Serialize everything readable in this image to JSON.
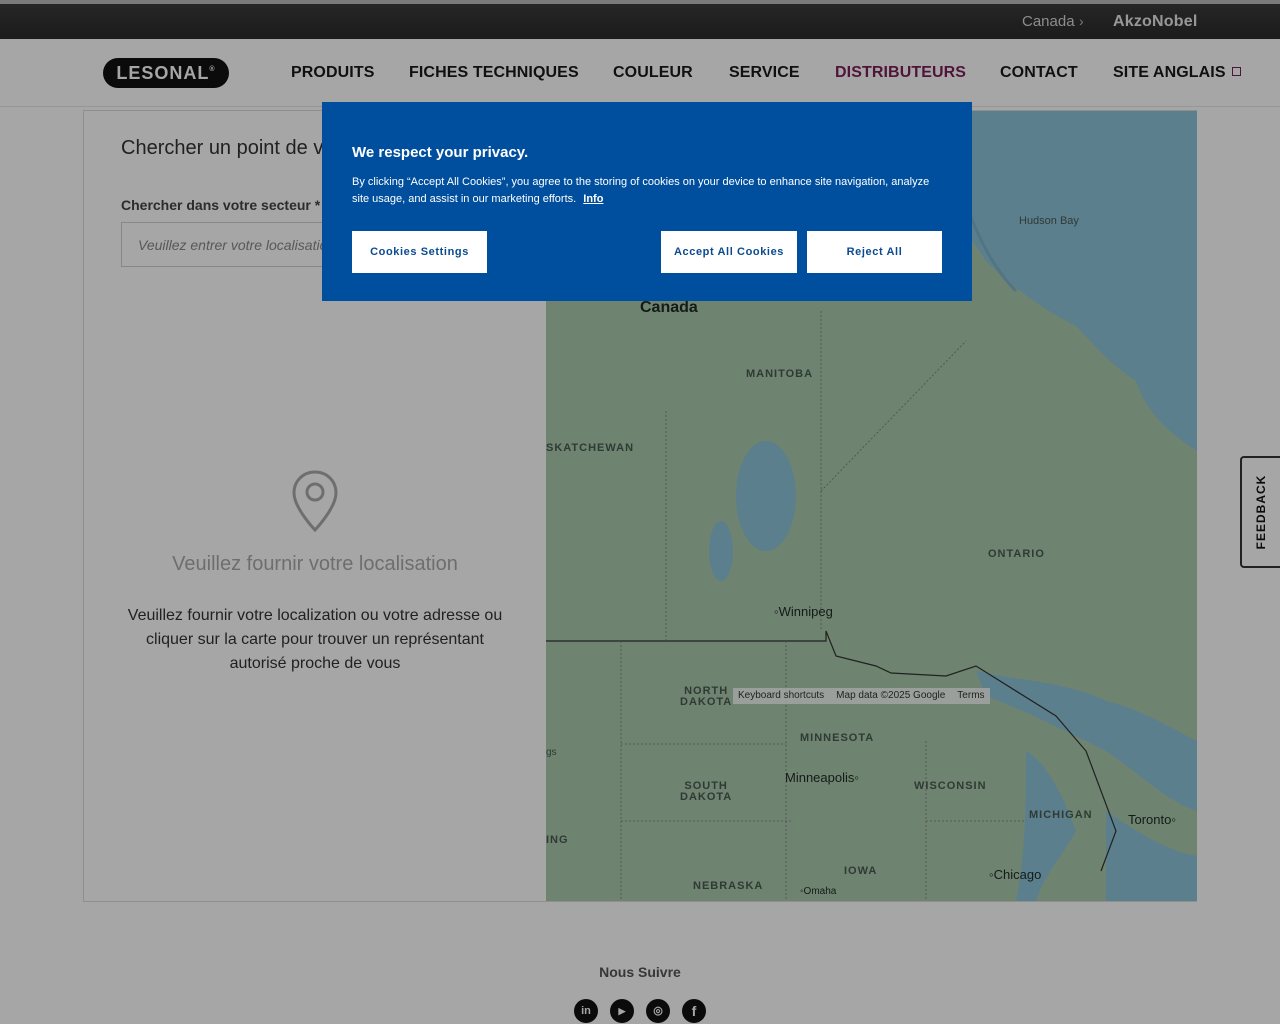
{
  "topbar": {
    "country": "Canada",
    "chevron": "›",
    "brand": "AkzoNobel"
  },
  "header": {
    "logo": "LESONAL",
    "logo_mark": "®",
    "nav": [
      {
        "label": "PRODUITS"
      },
      {
        "label": "FICHES TECHNIQUES"
      },
      {
        "label": "COULEUR"
      },
      {
        "label": "SERVICE"
      },
      {
        "label": "DISTRIBUTEURS",
        "active": true
      },
      {
        "label": "CONTACT"
      },
      {
        "label": "SITE ANGLAIS",
        "icon": "external-link-icon"
      }
    ]
  },
  "locator": {
    "title": "Chercher un point de vente",
    "search_label": "Chercher dans votre secteur *",
    "search_placeholder": "Veuillez entrer votre localisation",
    "empty_heading": "Veuillez fournir votre localisation",
    "empty_text": "Veuillez fournir votre localization ou votre adresse ou cliquer sur la carte pour trouver un représentant autorisé proche de vous"
  },
  "map": {
    "labels": {
      "hudson_bay": "Hudson Bay",
      "canada": "Canada",
      "manitoba": "MANITOBA",
      "saskatchewan": "SKATCHEWAN",
      "ontario": "ONTARIO",
      "north_dakota": "NORTH\nDAKOTA",
      "minnesota": "MINNESOTA",
      "south_dakota": "SOUTH\nDAKOTA",
      "wisconsin": "WISCONSIN",
      "michigan": "MICHIGAN",
      "iowa": "IOWA",
      "nebraska": "NEBRASKA",
      "wyoming_partial": "ING",
      "edge_partial": "gs"
    },
    "cities": {
      "winnipeg": "Winnipeg",
      "minneapolis": "Minneapolis",
      "toronto": "Toronto",
      "chicago": "Chicago",
      "omaha": "Omaha"
    },
    "footer": {
      "shortcuts": "Keyboard shortcuts",
      "data": "Map data ©2025 Google",
      "terms": "Terms"
    }
  },
  "cookie": {
    "title": "We respect your privacy.",
    "text": "By clicking “Accept All Cookies”, you agree to the storing of cookies on your device to enhance site navigation, analyze site usage, and assist in our marketing efforts.",
    "info_link": "Info",
    "settings_button": "Cookies Settings",
    "accept_button": "Accept All Cookies",
    "reject_button": "Reject All"
  },
  "footer": {
    "follow": "Nous Suivre",
    "social": [
      {
        "icon": "linkedin-icon",
        "glyph": "in"
      },
      {
        "icon": "youtube-icon",
        "glyph": "▶"
      },
      {
        "icon": "instagram-icon",
        "glyph": "◎"
      },
      {
        "icon": "facebook-icon",
        "glyph": "f"
      }
    ]
  },
  "feedback": "FEEDBACK",
  "colors": {
    "accent": "#7b1f5a",
    "cookie_bg": "#004f9e",
    "topbar": "#2f2f2f"
  }
}
